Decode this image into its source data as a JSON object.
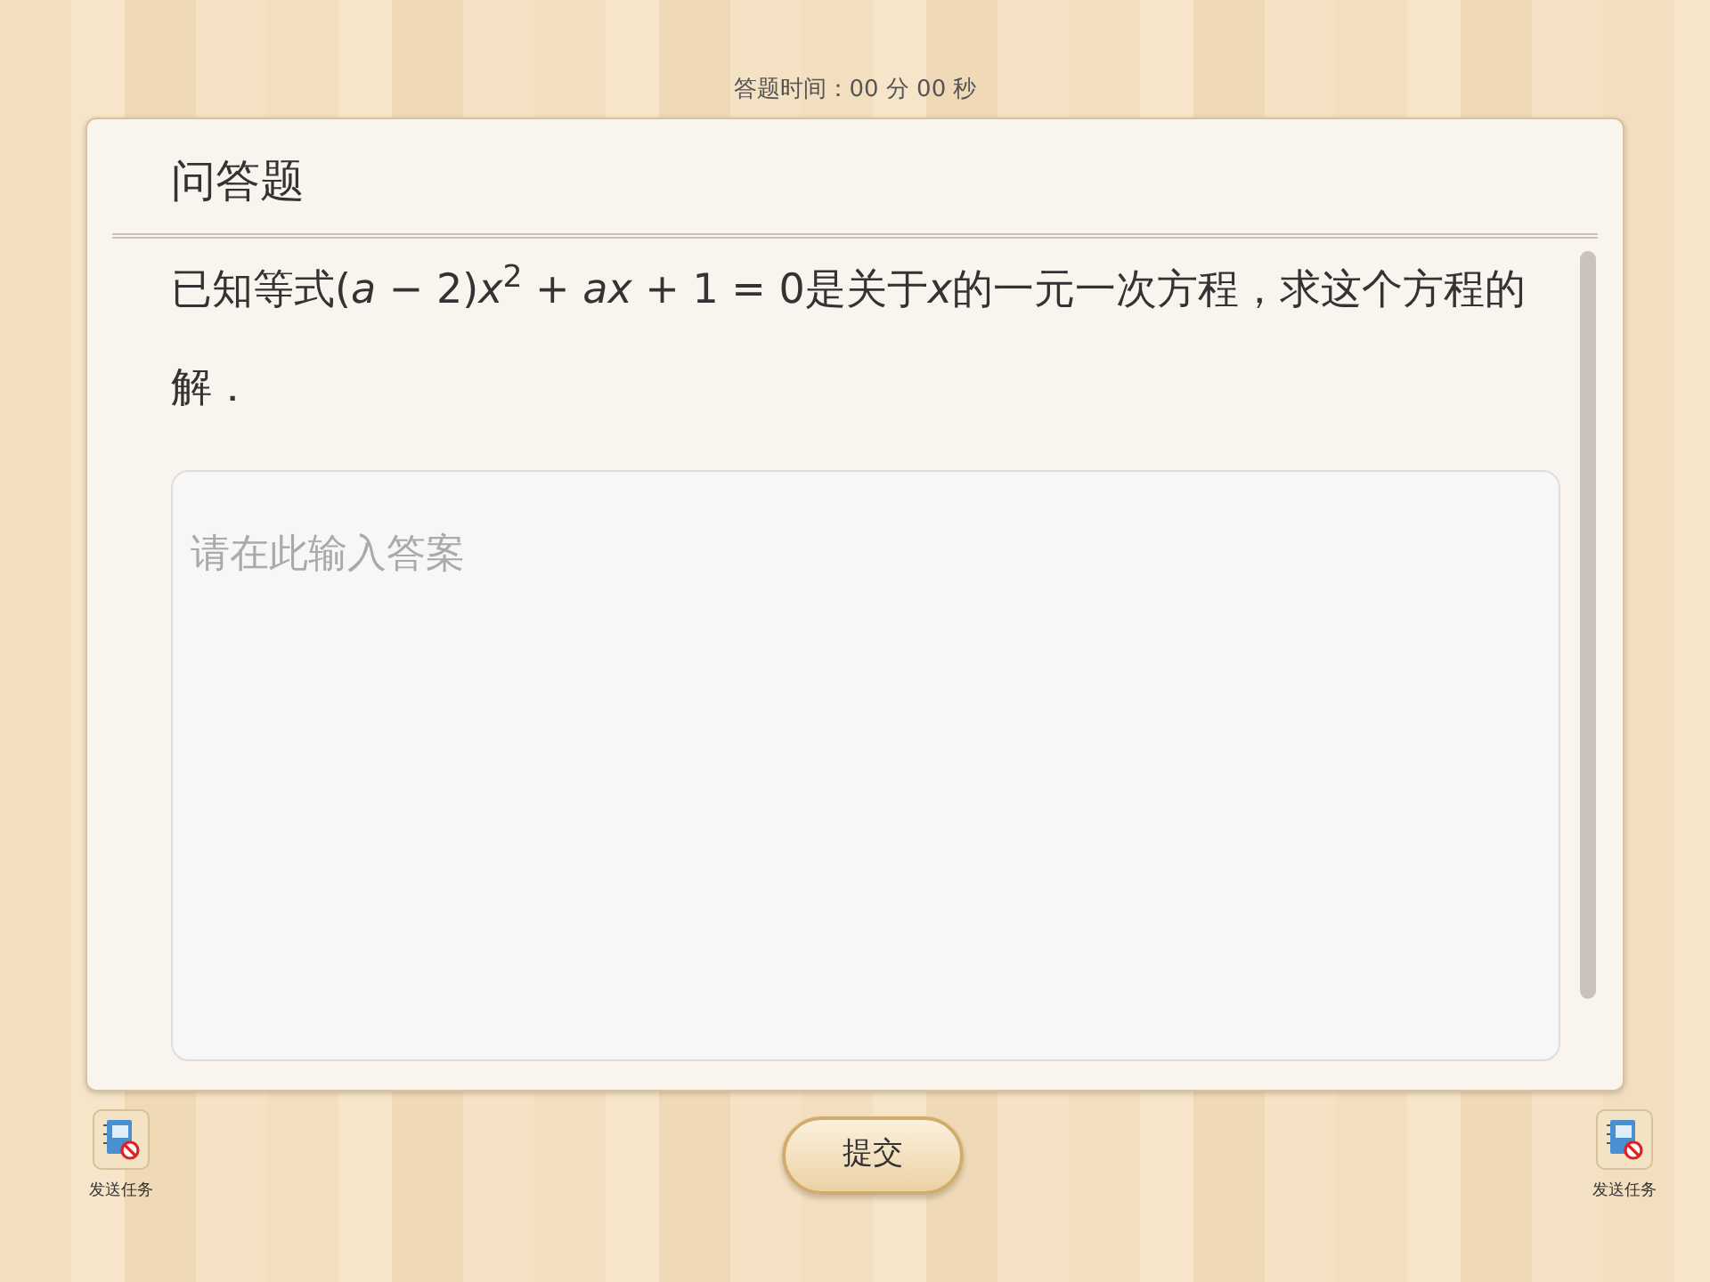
{
  "timer": "答题时间：00 分 00 秒",
  "card": {
    "title": "问答题",
    "question": [
      "已知等式(*a* − 2)*x*$^{2}$ + *ax* + 1 = 0是关于",
      "*x*",
      "的一元一次方程，求这个方程的解．"
    ],
    "answer": {
      "placeholder": "请在此输入答案"
    }
  },
  "footer": {
    "left_task": {
      "label": "发送任务"
    },
    "submit": "提交",
    "right_task": {
      "label": "发送任务"
    }
  }
}
